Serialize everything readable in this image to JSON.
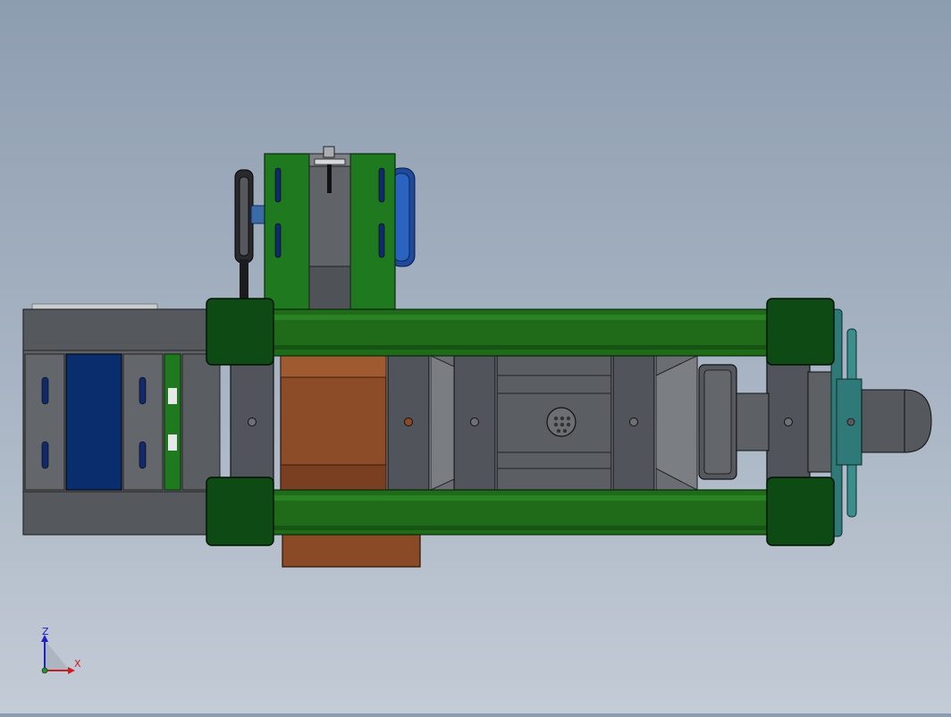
{
  "viewport": {
    "background_top": "#8d9db0",
    "background_bottom": "#c3cbd6"
  },
  "triad": {
    "z_label": "Z",
    "x_label": "X",
    "z_color": "#1a22c8",
    "x_color": "#c81e1e"
  },
  "colors": {
    "frame_green": "#1f6b1a",
    "corner_green": "#0d4a14",
    "steel_gray": "#5f6266",
    "dark_gray": "#4a4c50",
    "copper": "#8a4a26",
    "motor_blue": "#0e2a6e",
    "teal": "#2f7a78"
  }
}
